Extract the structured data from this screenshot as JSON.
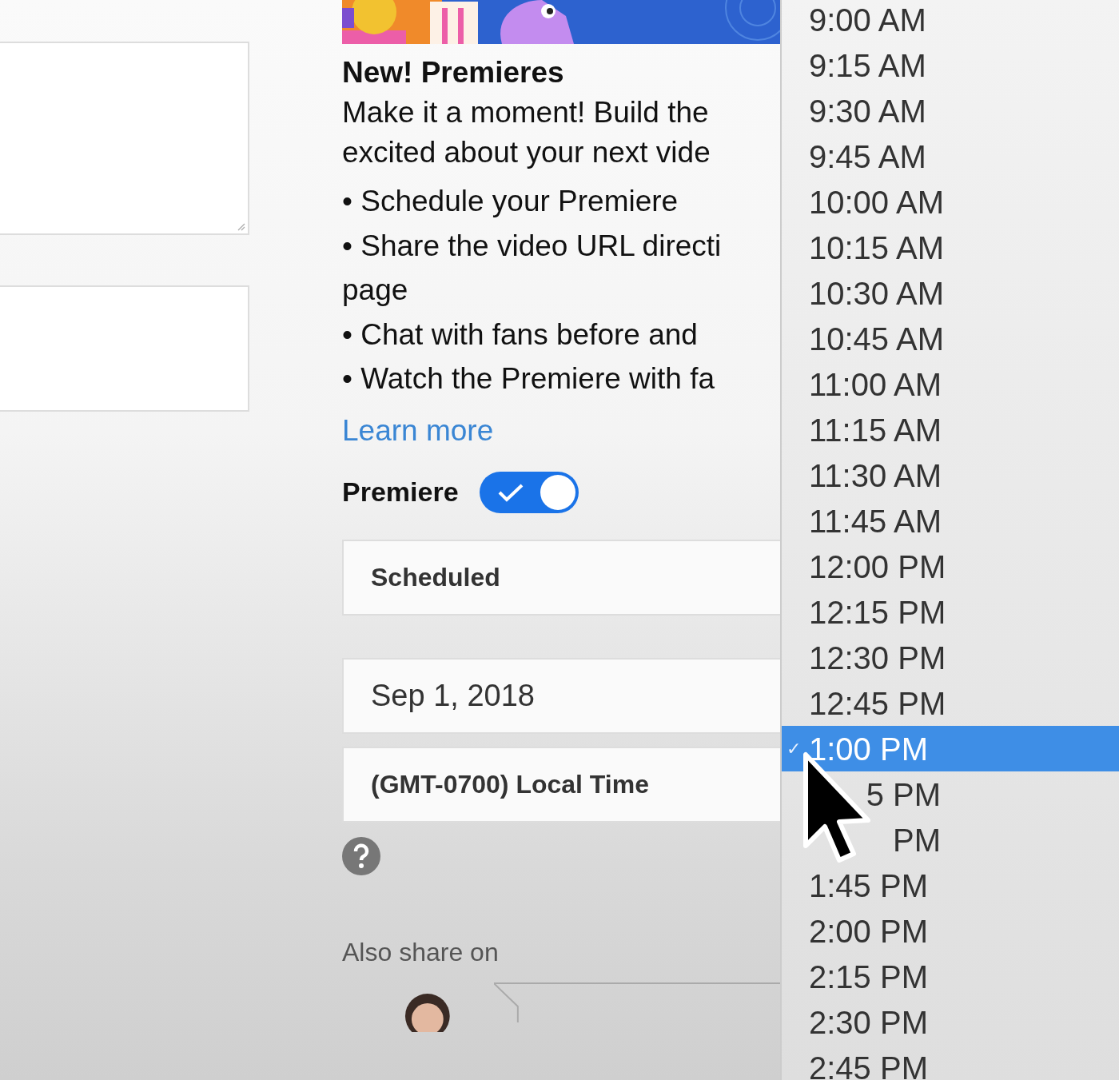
{
  "promo": {
    "title": "New! Premieres",
    "intro": [
      "Make it a moment! Build the",
      "excited about your next vide"
    ],
    "bullets": [
      "• Schedule your Premiere",
      "• Share the video URL directi",
      "page",
      "• Chat with fans before and",
      "• Watch the Premiere with fa"
    ],
    "link": "Learn more"
  },
  "premiere": {
    "label": "Premiere",
    "on": true
  },
  "visibility": {
    "value": "Scheduled"
  },
  "date": {
    "value": "Sep 1, 2018"
  },
  "timezone": {
    "value": "(GMT-0700) Local Time"
  },
  "share": {
    "label": "Also share on"
  },
  "time_dropdown": {
    "items": [
      {
        "label": "9:00 AM",
        "selected": false
      },
      {
        "label": "9:15 AM",
        "selected": false
      },
      {
        "label": "9:30 AM",
        "selected": false
      },
      {
        "label": "9:45 AM",
        "selected": false
      },
      {
        "label": "10:00 AM",
        "selected": false
      },
      {
        "label": "10:15 AM",
        "selected": false
      },
      {
        "label": "10:30 AM",
        "selected": false
      },
      {
        "label": "10:45 AM",
        "selected": false
      },
      {
        "label": "11:00 AM",
        "selected": false
      },
      {
        "label": "11:15 AM",
        "selected": false
      },
      {
        "label": "11:30 AM",
        "selected": false
      },
      {
        "label": "11:45 AM",
        "selected": false
      },
      {
        "label": "12:00 PM",
        "selected": false
      },
      {
        "label": "12:15 PM",
        "selected": false
      },
      {
        "label": "12:30 PM",
        "selected": false
      },
      {
        "label": "12:45 PM",
        "selected": false
      },
      {
        "label": "1:00 PM",
        "selected": true,
        "mark": "✓"
      },
      {
        "label": "5 PM",
        "selected": false,
        "kind": "partial"
      },
      {
        "label": "PM",
        "selected": false,
        "kind": "partial"
      },
      {
        "label": "1:45 PM",
        "selected": false
      },
      {
        "label": "2:00 PM",
        "selected": false
      },
      {
        "label": "2:15 PM",
        "selected": false
      },
      {
        "label": "2:30 PM",
        "selected": false
      },
      {
        "label": "2:45 PM",
        "selected": false
      }
    ]
  }
}
